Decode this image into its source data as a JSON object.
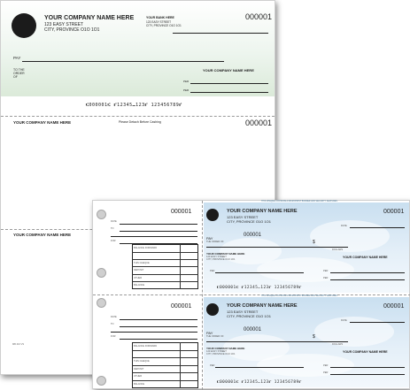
{
  "company": {
    "name": "YOUR COMPANY NAME HERE",
    "street": "123 EASY STREET",
    "city": "CITY, PROVINCE  O1O 1O1"
  },
  "bank": {
    "name": "YOUR BANK HERE",
    "street": "123 EASY STREET",
    "city": "CITY, PROVINCE  O1O 1O1"
  },
  "cheque_number": "000001",
  "micr": "⑆000001⑆ ⑈12345⑉123⑈ 123456789⑈",
  "micr_short": "⑆000001⑆ ⑈12345⑉123⑈ 123456789⑈",
  "labels": {
    "pay": "PAY",
    "to_the_order_of_1": "TO THE",
    "to_the_order_of_2": "ORDER",
    "to_the_order_of_3": "OF",
    "per": "PER",
    "date": "DATE",
    "dollars": "DOLLARS",
    "the_order_of": "THE ORDER OF",
    "detach": "Please Detach Before Cashing",
    "balance_forward": "BALANCE FORWARD",
    "this_cheque": "THIS CHEQUE",
    "deposit": "DEPOSIT",
    "other": "OTHER",
    "balance": "BALANCE",
    "date_small": "DATE",
    "to": "TO",
    "for": "FOR",
    "dollar_sign": "$",
    "security_note": "THIS CHEQUE CONTAINS A MICROPRINT BORDER AND SECURITY FEATURES",
    "form_code": "MB 416 VS"
  }
}
